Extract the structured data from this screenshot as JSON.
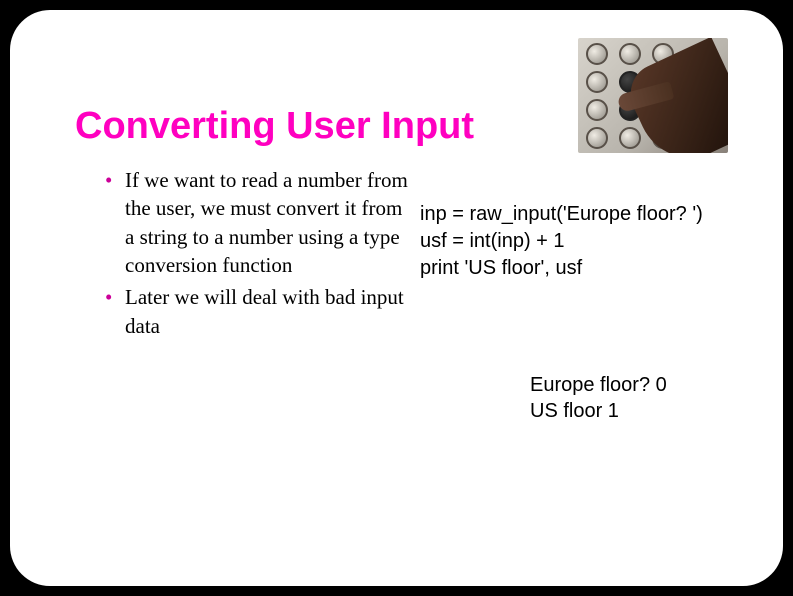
{
  "title": "Converting User Input",
  "bullets": [
    "If we want to read a number from the user, we must convert it from a string to a number using a type conversion function",
    "Later we will deal with bad input data"
  ],
  "code": {
    "line1": "inp = raw_input('Europe floor? ')",
    "line2": "usf = int(inp) + 1",
    "line3": "print 'US floor', usf"
  },
  "output": {
    "line1": "Europe floor? 0",
    "line2": "US floor 1"
  },
  "image_alt": "elevator-keypad-with-hand"
}
